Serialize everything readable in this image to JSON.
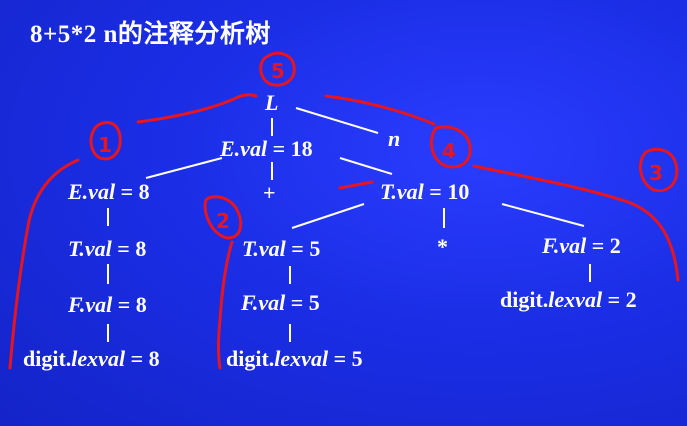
{
  "title": "8+5*2 n的注释分析树",
  "nodes": {
    "L": {
      "italic": "L",
      "rest": ""
    },
    "n": {
      "italic": "n",
      "rest": ""
    },
    "E_root": {
      "italic": "E.val",
      "rest": " = 18"
    },
    "E_left": {
      "italic": "E.val",
      "rest": " = 8"
    },
    "plus": {
      "italic": "",
      "rest": "+"
    },
    "T_right": {
      "italic": "T.val",
      "rest": " = 10"
    },
    "T_left": {
      "italic": "T.val",
      "rest": " = 8"
    },
    "T_mid": {
      "italic": "T.val",
      "rest": " = 5"
    },
    "star": {
      "italic": "",
      "rest": "*"
    },
    "F_right": {
      "italic": "F.val",
      "rest": " = 2"
    },
    "F_left": {
      "italic": "F.val",
      "rest": " = 8"
    },
    "F_mid": {
      "italic": "F.val",
      "rest": " = 5"
    },
    "digit_right": {
      "plain": "digit.",
      "italic": "lexval",
      "rest": " = 2"
    },
    "digit_left": {
      "plain": "digit.",
      "italic": "lexval",
      "rest": " = 8"
    },
    "digit_mid": {
      "plain": "digit.",
      "italic": "lexval",
      "rest": " = 5"
    }
  },
  "annotations": [
    "1",
    "2",
    "3",
    "4",
    "5"
  ],
  "colors": {
    "background": "#1b2ee6",
    "text": "#ffffff",
    "pen": "#e8141e"
  }
}
